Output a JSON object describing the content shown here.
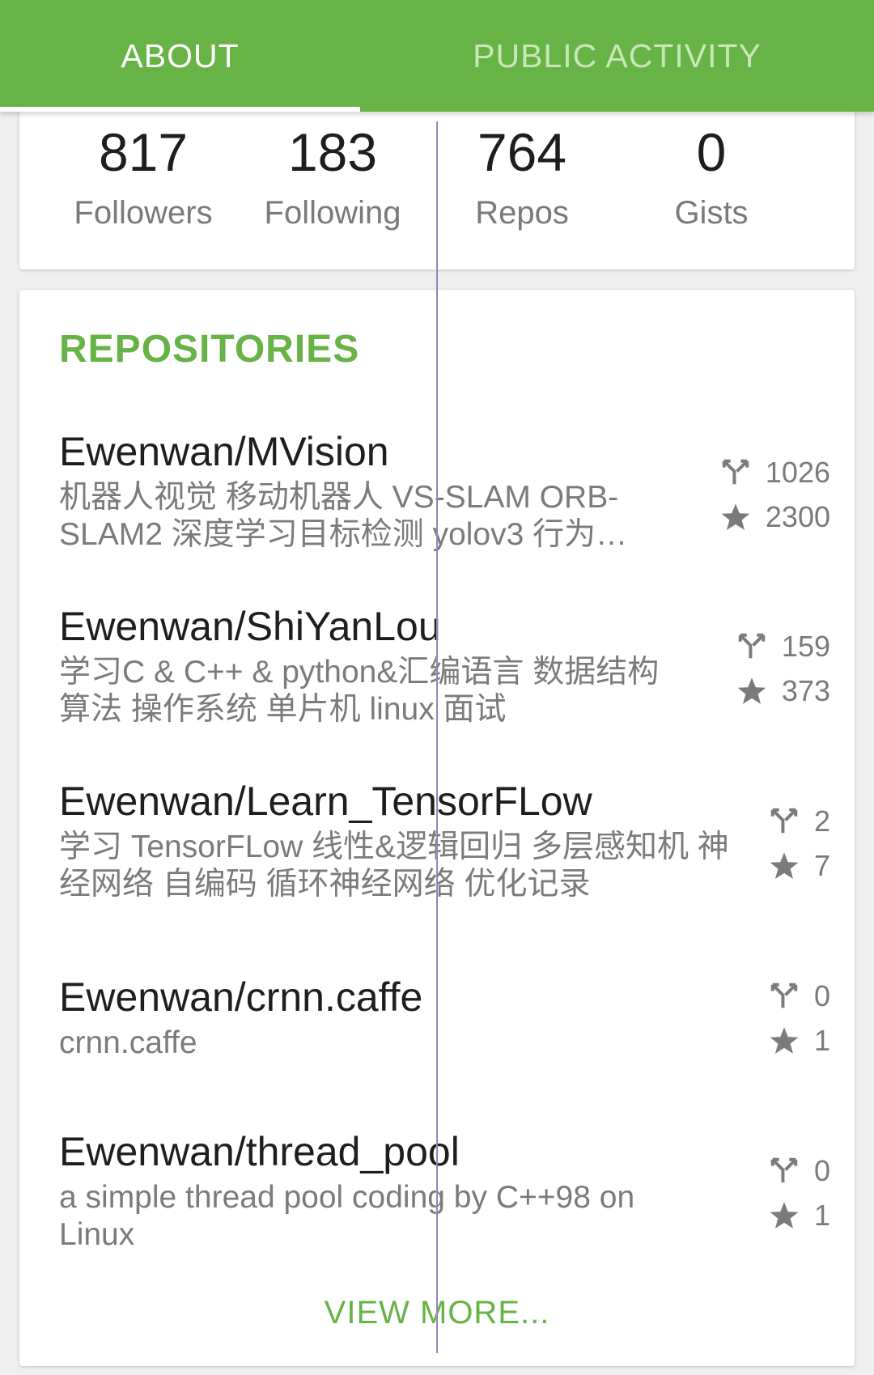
{
  "tabs": {
    "about": "ABOUT",
    "activity": "PUBLIC ACTIVITY"
  },
  "stats": [
    {
      "value": "817",
      "label": "Followers"
    },
    {
      "value": "183",
      "label": "Following"
    },
    {
      "value": "764",
      "label": "Repos"
    },
    {
      "value": "0",
      "label": "Gists"
    }
  ],
  "repos": {
    "heading": "REPOSITORIES",
    "items": [
      {
        "name": "Ewenwan/MVision",
        "desc": "机器人视觉 移动机器人 VS-SLAM ORB-SLAM2 深度学习目标检测 yolov3 行为…",
        "forks": "1026",
        "stars": "2300"
      },
      {
        "name": "Ewenwan/ShiYanLou",
        "desc": "学习C & C++ & python&汇编语言 数据结构 算法 操作系统 单片机 linux 面试",
        "forks": "159",
        "stars": "373"
      },
      {
        "name": "Ewenwan/Learn_TensorFLow",
        "desc": "学习 TensorFLow 线性&逻辑回归 多层感知机 神经网络 自编码 循环神经网络 优化记录",
        "forks": "2",
        "stars": "7"
      },
      {
        "name": "Ewenwan/crnn.caffe",
        "desc": "crnn.caffe",
        "forks": "0",
        "stars": "1"
      },
      {
        "name": "Ewenwan/thread_pool",
        "desc": "a simple thread pool coding by C++98 on Linux",
        "forks": "0",
        "stars": "1"
      }
    ],
    "view_more": "VIEW MORE..."
  },
  "colors": {
    "accent": "#67b346",
    "tab_inactive": "#c9e6b6",
    "text_primary": "#1e1e1e",
    "text_secondary": "#7b7b7b"
  },
  "icons": {
    "fork": "fork-icon",
    "star": "star-icon"
  }
}
